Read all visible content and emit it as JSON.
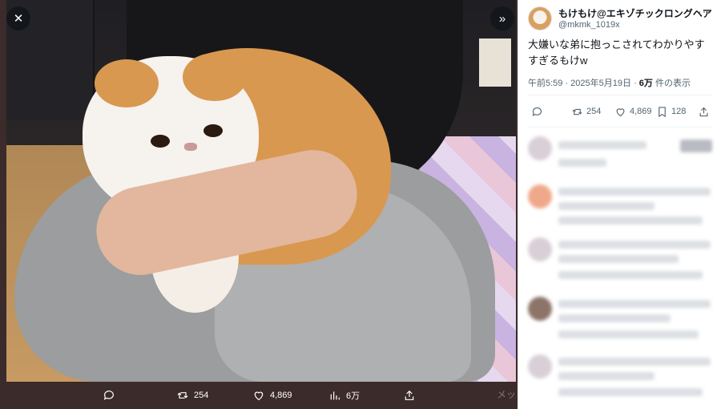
{
  "viewer": {
    "close_icon": "close-icon",
    "expand_icon": "chevrons-right-icon",
    "actions": {
      "reply_count": "",
      "retweet_count": "254",
      "like_count": "4,869",
      "views_count": "6万"
    },
    "faint_text": "メッ"
  },
  "tweet": {
    "author_name": "もけもけ@エキゾチックロングヘア",
    "author_handle": "@mkmk_1019x",
    "more_label": "···",
    "text": "大嫌いな弟に抱っこされてわかりやすすぎるもけw",
    "time": "午前5:59 · 2025年5月19日 · ",
    "views": "6万",
    "views_suffix": " 件の表示",
    "retweet_count": "254",
    "like_count": "4,869",
    "bookmark_count": "128"
  },
  "colors": {
    "viewer_bg": "#3b2b2a",
    "text_primary": "#0f1419",
    "text_secondary": "#536471"
  }
}
